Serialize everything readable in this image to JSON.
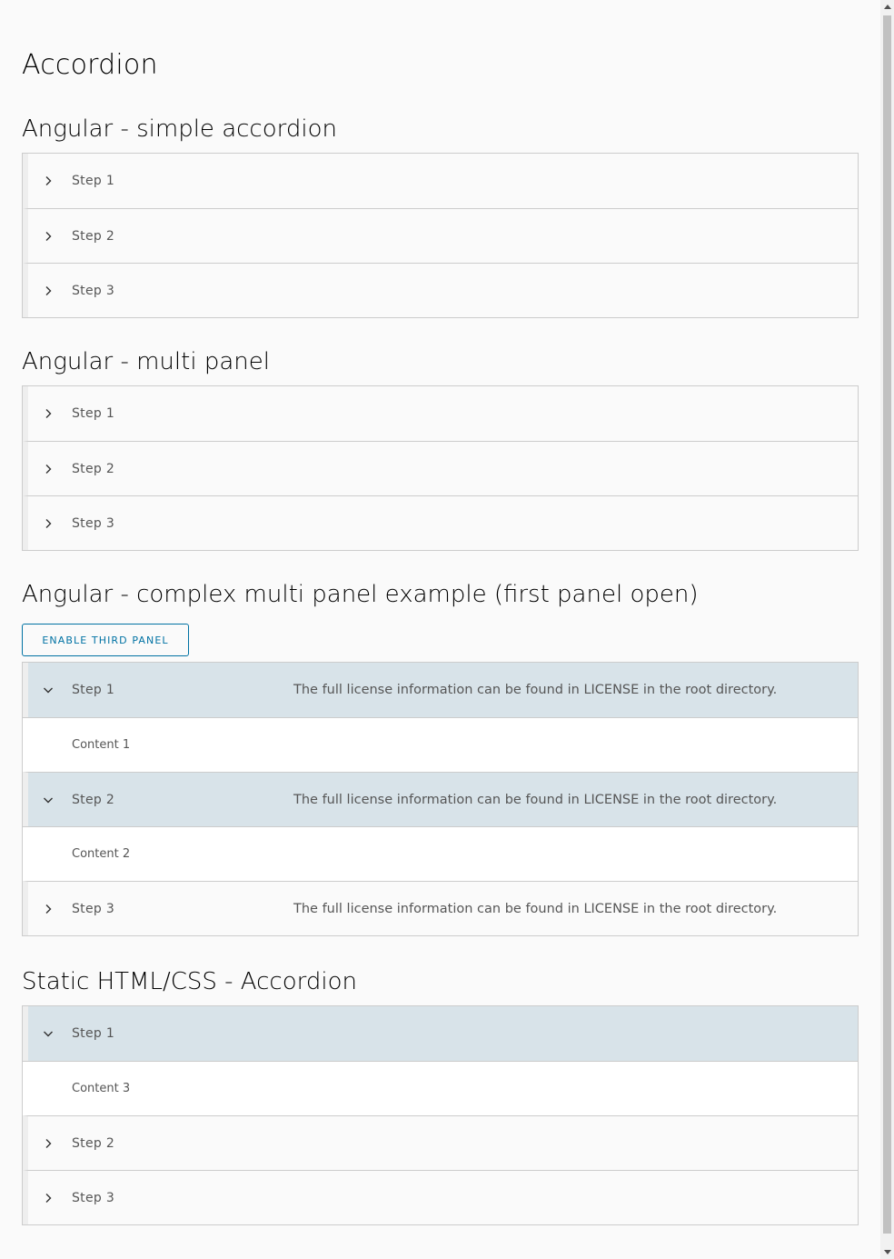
{
  "page": {
    "title": "Accordion"
  },
  "sections": [
    {
      "title": "Angular - simple accordion",
      "panels": [
        {
          "label": "Step 1",
          "state": "collapsed"
        },
        {
          "label": "Step 2",
          "state": "collapsed"
        },
        {
          "label": "Step 3",
          "state": "collapsed"
        }
      ]
    },
    {
      "title": "Angular - multi panel",
      "panels": [
        {
          "label": "Step 1",
          "state": "collapsed"
        },
        {
          "label": "Step 2",
          "state": "collapsed"
        },
        {
          "label": "Step 3",
          "state": "collapsed"
        }
      ]
    },
    {
      "title": "Angular - complex multi panel example (first panel open)",
      "button_label": "Enable third panel",
      "panels": [
        {
          "label": "Step 1",
          "description": "The full license information can be found in LICENSE in the root directory.",
          "state": "expanded",
          "content": "Content 1"
        },
        {
          "label": "Step 2",
          "description": "The full license information can be found in LICENSE in the root directory.",
          "state": "expanded",
          "content": "Content 2"
        },
        {
          "label": "Step 3",
          "description": "The full license information can be found in LICENSE in the root directory.",
          "state": "collapsed"
        }
      ]
    },
    {
      "title": "Static HTML/CSS - Accordion",
      "panels": [
        {
          "label": "Step 1",
          "state": "expanded",
          "content": "Content 3"
        },
        {
          "label": "Step 2",
          "state": "collapsed"
        },
        {
          "label": "Step 3",
          "state": "collapsed"
        }
      ]
    }
  ],
  "icons": {
    "collapsed": "chevron-right-icon",
    "expanded": "chevron-down-icon"
  },
  "colors": {
    "accent": "#0072a3",
    "open_header_bg": "#d8e3e9",
    "border": "#cccccc"
  }
}
